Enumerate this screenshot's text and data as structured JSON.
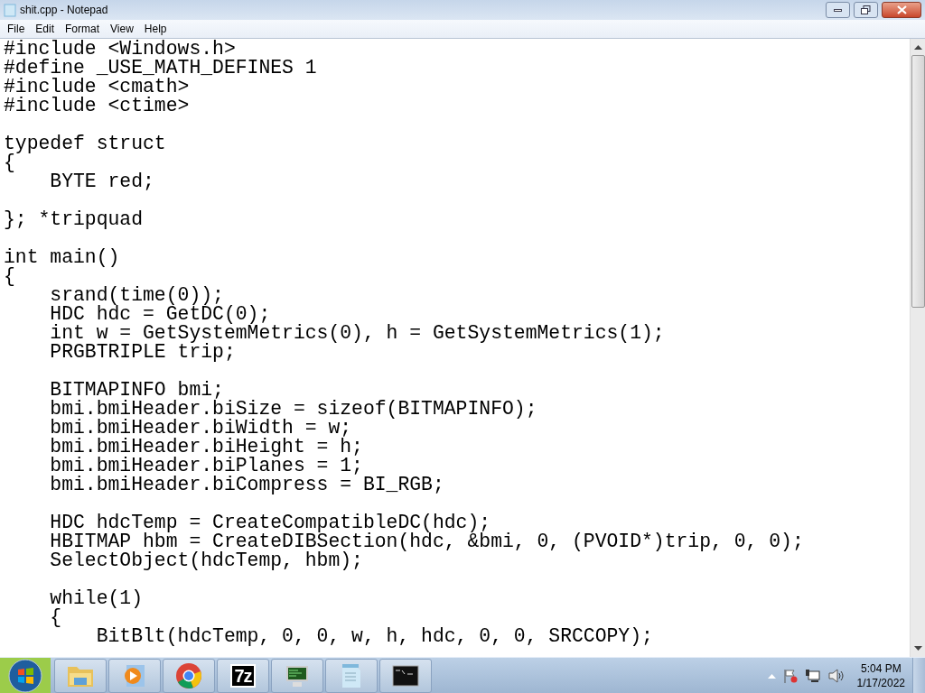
{
  "window": {
    "title": "shit.cpp - Notepad"
  },
  "menu": [
    "File",
    "Edit",
    "Format",
    "View",
    "Help"
  ],
  "editor": {
    "paragraphs": [
      [
        "#include <Windows.h>",
        "#define _USE_MATH_DEFINES 1",
        "#include <cmath>",
        "#include <ctime>"
      ],
      [
        "typedef struct",
        "{",
        "    BYTE red;"
      ],
      [
        "}; *tripquad"
      ],
      [
        "int main()",
        "{",
        "    srand(time(0));",
        "    HDC hdc = GetDC(0);",
        "    int w = GetSystemMetrics(0), h = GetSystemMetrics(1);",
        "    PRGBTRIPLE trip;"
      ],
      [
        "    BITMAPINFO bmi;",
        "    bmi.bmiHeader.biSize = sizeof(BITMAPINFO);",
        "    bmi.bmiHeader.biWidth = w;",
        "    bmi.bmiHeader.biHeight = h;",
        "    bmi.bmiHeader.biPlanes = 1;",
        "    bmi.bmiHeader.biCompress = BI_RGB;"
      ],
      [
        "    HDC hdcTemp = CreateCompatibleDC(hdc);",
        "    HBITMAP hbm = CreateDIBSection(hdc, &bmi, 0, (PVOID*)trip, 0, 0);",
        "    SelectObject(hdcTemp, hbm);"
      ],
      [
        "    while(1)",
        "    {",
        "        BitBlt(hdcTemp, 0, 0, w, h, hdc, 0, 0, SRCCOPY);"
      ]
    ]
  },
  "taskbar": {
    "apps": [
      {
        "kind": "folder"
      },
      {
        "kind": "media"
      },
      {
        "kind": "chrome"
      },
      {
        "kind": "sevenzip",
        "label": "7z"
      },
      {
        "kind": "monitor"
      },
      {
        "kind": "notepad"
      },
      {
        "kind": "console"
      }
    ],
    "clock": {
      "time": "5:04 PM",
      "date": "1/17/2022"
    }
  }
}
